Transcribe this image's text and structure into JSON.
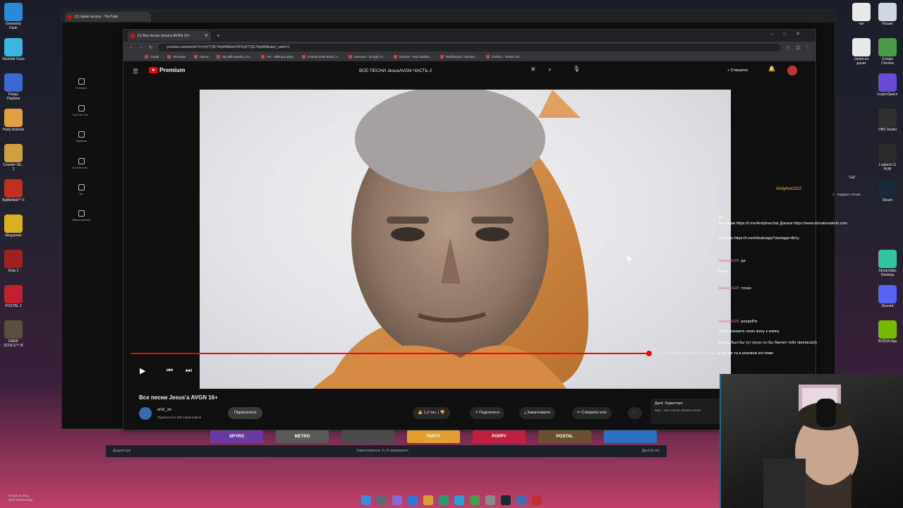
{
  "desktop": {
    "left_icons": [
      {
        "label": "Geometry Dash",
        "color": "#2a8ad8"
      },
      {
        "label": "Stumble Guys",
        "color": "#3bb6e0"
      },
      {
        "label": "Poppy Playtime",
        "color": "#3a6ad0"
      },
      {
        "label": "Party Animals",
        "color": "#e0a040"
      },
      {
        "label": "Counter-Str... 2",
        "color": "#d0a040"
      },
      {
        "label": "Battlefield™ 6",
        "color": "#c03020"
      },
      {
        "label": "Megabonk",
        "color": "#d8b020"
      },
      {
        "label": "Dota 2",
        "color": "#a02020"
      },
      {
        "label": "POSTAL 2",
        "color": "#c02030"
      },
      {
        "label": "DARK SOULS™ III",
        "color": "#5a5040"
      }
    ],
    "right_icons": [
      {
        "label": "чат",
        "color": "#e8e8e8"
      },
      {
        "label": "Кошик",
        "color": "#cfd8e0"
      },
      {
        "label": "силка на донат",
        "color": "#e8e8e8"
      },
      {
        "label": "Google Chrome",
        "color": "#4a9a4a"
      },
      {
        "label": "LegionSpace",
        "color": "#6a4ad8"
      },
      {
        "label": "OBS Studio",
        "color": "#303030"
      },
      {
        "label": "Logitech G HUB",
        "color": "#2a2a2a"
      },
      {
        "label": "Steam",
        "color": "#1b2838"
      },
      {
        "label": "Streamlabs Desktop",
        "color": "#31c3a2"
      },
      {
        "label": "Discord",
        "color": "#5865f2"
      },
      {
        "label": "NVIDIA App",
        "color": "#76b900"
      }
    ],
    "weather": {
      "line1": "Temps to drop",
      "line2": "Next Wednesday"
    },
    "taskbar_icons": [
      "start-icon",
      "file-explorer-icon",
      "search-icon",
      "edge-icon",
      "files-icon",
      "store-icon",
      "telegram-icon",
      "chrome-icon",
      "app-icon",
      "steam-icon",
      "app-icon-2",
      "obs-icon"
    ]
  },
  "back_window": {
    "tab_title": "(1) треки хесуса - YouTube",
    "sidebar": [
      "Головна",
      "YouTube Sh...",
      "Підписки",
      "YouTube Mu...",
      "Ви",
      "Завантаження"
    ]
  },
  "browser": {
    "tab_title": "(1) Все песни Jesus'a AVGN 16+",
    "url": "youtube.com/watch?v=XyFTQE7AqW8&list=RDXyFTQE7AqW8&start_radio=1",
    "bookmarks": [
      "Gmail",
      "YouTube",
      "Карти",
      "My Bill Details | Co...",
      "TIX - BillingActivity",
      "Central Park East | A...",
      "Devices - Google H...",
      "Stream - Kick Dashb...",
      "Dashboard / Stream...",
      "Carbon - Twitch Ov..."
    ]
  },
  "youtube": {
    "logo_text": "Premium",
    "search_query": "ВСЕ ПЕСНИ JesusAVGN ЧАСТЬ 2",
    "create_label": "Створити",
    "notification_count": "1",
    "video_title": "Все песни Jesus'a AVGN 16+",
    "channel_name": "snic_xx",
    "channel_subs": "Підписалося 920 користувача",
    "subscribe_label": "Підписатися",
    "like_label": "1,2 тис.",
    "share_label": "Поділитися",
    "download_label": "Завантажити",
    "clip_label": "Створити кліп",
    "next_up_title": "Далі: Superman",
    "next_up_sub": "Мікс – Все песни Jesus'a AVGN",
    "progress": 0.88,
    "thumbnails": [
      {
        "label": "SPYRO",
        "color": "#6a3aa0"
      },
      {
        "label": "METRO",
        "color": "#5a5a5a"
      },
      {
        "label": "",
        "color": "#4a4a4a"
      },
      {
        "label": "PARTY",
        "color": "#e0a030"
      },
      {
        "label": "POPPY",
        "color": "#c02040"
      },
      {
        "label": "POSTAL",
        "color": "#6a5030"
      },
      {
        "label": "",
        "color": "#3070c0"
      }
    ]
  },
  "steam_bar": {
    "left": "Додати гру",
    "middle": "Завантаження: 5 з 5 завершено",
    "right": "Друзі й чат"
  },
  "chat": {
    "header_user": "Andylive1312",
    "header_note": "1 · подарок стільки",
    "label": "Чат",
    "lines": [
      {
        "user": "",
        "text": "да"
      },
      {
        "user": "",
        "text": "Телеграм https://t.me/Andylivechat Донати https://www.donationalerts.com"
      },
      {
        "user": "",
        "text": "Трейдик https://t.me/tribute/app?startapp=dk1y"
      },
      {
        "user": "",
        "text": ""
      },
      {
        "user": "Galaxy5928",
        "text": "да"
      },
      {
        "user": "",
        "text": "forest"
      },
      {
        "user": "",
        "text": ""
      },
      {
        "user": "Galaxy5928",
        "text": "точно"
      },
      {
        "user": "",
        "text": ""
      },
      {
        "user": "",
        "text": ""
      },
      {
        "user": "Galaxy5928",
        "text": "peepoPls"
      },
      {
        "user": "",
        "text": "Энди позовите свою жену к компу"
      },
      {
        "user": "",
        "text": "Ахаха, был бы тут хесус он бы банчит тебе прописал))"
      },
      {
        "user": "",
        "text": "а как же та в розовом костюме"
      }
    ]
  }
}
